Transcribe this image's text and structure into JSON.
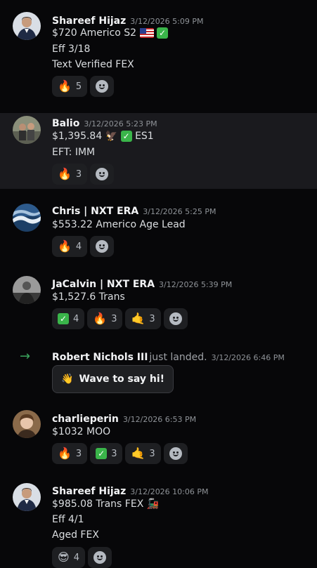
{
  "messages": [
    {
      "author": "Shareef Hijaz",
      "time": "3/12/2026 5:09 PM",
      "lines": [
        "$720 Americo S2",
        "Eff 3/18",
        "Text Verified FEX"
      ],
      "reactions": [
        {
          "emoji": "🔥",
          "count": "5"
        }
      ]
    },
    {
      "author": "Balio",
      "time": "3/12/2026 5:23 PM",
      "lines": [
        "$1,395.84",
        "ES1",
        "EFT: IMM"
      ],
      "reactions": [
        {
          "emoji": "🔥",
          "count": "3"
        }
      ]
    },
    {
      "author": "Chris | NXT ERA",
      "time": "3/12/2026 5:25 PM",
      "lines": [
        "$553.22 Americo Age Lead"
      ],
      "reactions": [
        {
          "emoji": "🔥",
          "count": "4"
        }
      ]
    },
    {
      "author": "JaCalvin | NXT ERA",
      "time": "3/12/2026 5:39 PM",
      "lines": [
        "$1,527.6 Trans"
      ],
      "reactions": [
        {
          "emoji": "✅",
          "count": "4"
        },
        {
          "emoji": "🔥",
          "count": "3"
        },
        {
          "emoji": "🤙",
          "count": "3"
        }
      ]
    },
    {
      "author": "charlieperin",
      "time": "3/12/2026 6:53 PM",
      "lines": [
        "$1032 MOO"
      ],
      "reactions": [
        {
          "emoji": "🔥",
          "count": "3"
        },
        {
          "emoji": "✅",
          "count": "3"
        },
        {
          "emoji": "🤙",
          "count": "3"
        }
      ]
    },
    {
      "author": "Shareef Hijaz",
      "time": "3/12/2026 10:06 PM",
      "lines": [
        "$985.08 Trans FEX",
        "Eff 4/1",
        "Aged FEX"
      ],
      "reactions": [
        {
          "emoji": "😎",
          "count": "4"
        }
      ]
    }
  ],
  "system": {
    "author": "Robert Nichols III",
    "text": "just landed.",
    "time": "3/12/2026 6:46 PM",
    "wave_label": "Wave to say hi!",
    "wave_emoji": "👋"
  },
  "icons": {
    "eagle": "🦅",
    "train": "🚂",
    "arrow": "→"
  },
  "colors": {
    "background": "#070709",
    "highlight_row": "#1a1a1e",
    "join_arrow": "#3ba55d",
    "reaction_pill": "#1e1f22"
  }
}
